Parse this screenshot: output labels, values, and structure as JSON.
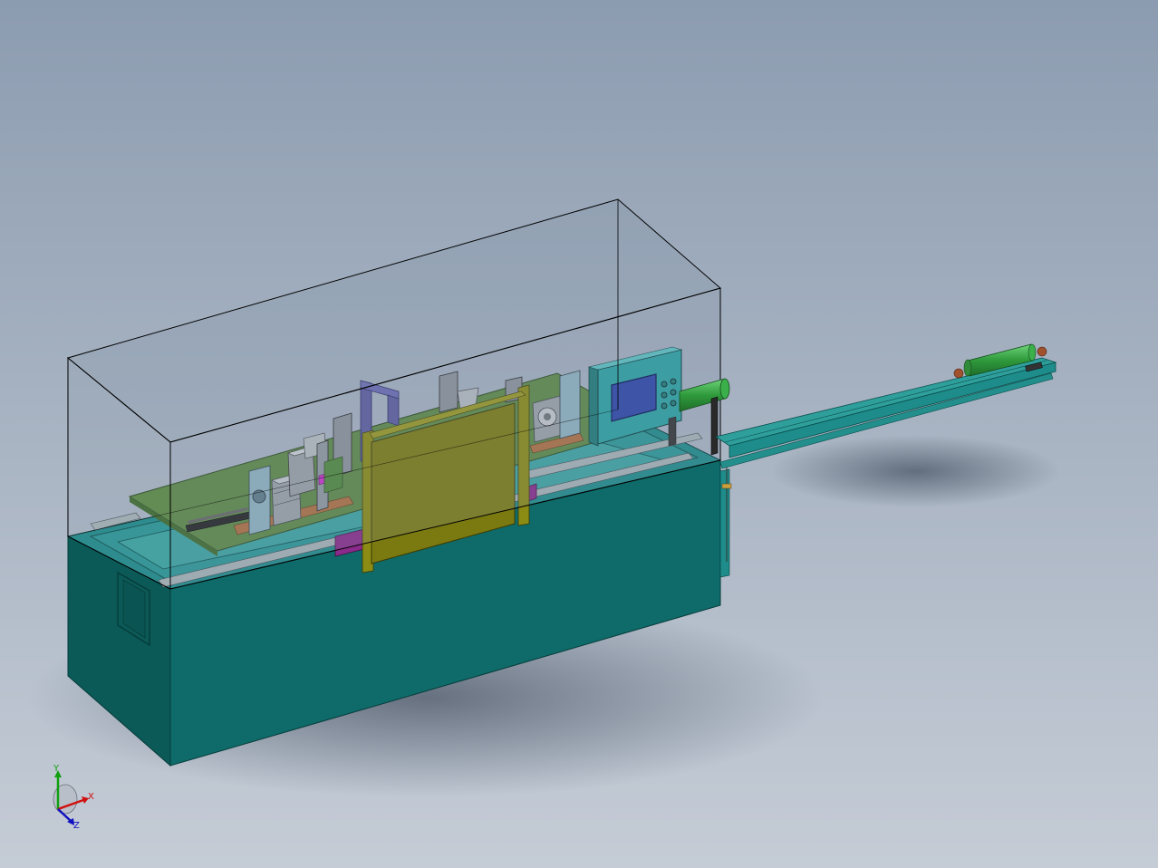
{
  "viewport": {
    "background_top": "#8c9cb0",
    "background_bottom": "#c5ccd6"
  },
  "model": {
    "colors": {
      "base_teal": "#0e6b69",
      "base_teal_dark": "#0a4f4d",
      "base_teal_top": "#1d8c8a",
      "enclosure_glass": "#7f8fa3",
      "enclosure_edge": "#000000",
      "plate_green": "#5d8a44",
      "door_olive": "#7b7a10",
      "door_olive_dark": "#5c5b08",
      "panel_teal": "#2aa3a3",
      "screen_blue": "#2b44a8",
      "green_cylinder": "#3bb04a",
      "rail_teal": "#2f9f9c",
      "purple_frame": "#5b5b9e",
      "magenta_block": "#8a2a8a",
      "motor_gray": "#9ba3a8",
      "copper": "#b07040"
    },
    "control_panel_buttons": 6
  },
  "triad": {
    "x_label": "X",
    "y_label": "Y",
    "z_label": "Z",
    "x_color": "#d01010",
    "y_color": "#10a010",
    "z_color": "#1010c0"
  }
}
